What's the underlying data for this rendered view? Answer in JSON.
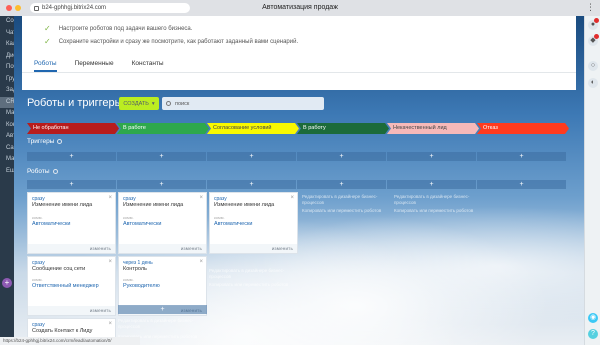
{
  "browser": {
    "url": "b24-gphhgj.bitrix24.com",
    "title": "Автоматизация продаж",
    "menu": "⋮"
  },
  "left_nav": {
    "items": [
      "Сооб",
      "Чат",
      "Кале",
      "Диск",
      "Поч",
      "Груп",
      "Зада",
      "CRM",
      "Мар",
      "Кон",
      "Авто",
      "Сай",
      "Маг",
      "Ещё"
    ],
    "active_index": 7,
    "plus": "+"
  },
  "hints": [
    "Настроите роботов под задачи вашего бизнеса.",
    "Сохраните настройки и сразу же посмотрите, как работают заданный вами сценарий."
  ],
  "tabs": [
    "Роботы",
    "Переменные",
    "Константы"
  ],
  "page": {
    "title": "Роботы и триггеры",
    "create_label": "СОЗДАТЬ",
    "search_value": "поиск"
  },
  "stages": [
    {
      "label": "Не обработан",
      "color": "#b71c1c",
      "text": "#ffffff"
    },
    {
      "label": "В работе",
      "color": "#2ea84c",
      "text": "#ffffff"
    },
    {
      "label": "Согласование условий",
      "color": "#f8f800",
      "text": "#444444"
    },
    {
      "label": "В работу",
      "color": "#1c6b3a",
      "text": "#ffffff"
    },
    {
      "label": "Некачественный лид",
      "color": "#f6b9b9",
      "text": "#444444"
    },
    {
      "label": "Отказ",
      "color": "#ff3b1f",
      "text": "#ffffff"
    }
  ],
  "sections": {
    "triggers": "Триггеры",
    "robots": "Роботы"
  },
  "add_symbol": "+",
  "cards": [
    {
      "when": "сразу",
      "name": "Изменение имени лида",
      "field": "комм.",
      "value": "Автоматически",
      "edit": "изменить"
    },
    {
      "when": "сразу",
      "name": "Изменение имени лида",
      "field": "комм.",
      "value": "Автоматически",
      "edit": "изменить"
    },
    {
      "when": "сразу",
      "name": "Изменение имени лида",
      "field": "комм.",
      "value": "Автоматически",
      "edit": "изменить"
    },
    {
      "when": "сразу",
      "name": "Сообщение соц сети",
      "field": "комм.",
      "value": "Ответственный менеджер",
      "edit": "изменить"
    },
    {
      "when": "через 1 день",
      "name": "Контроль",
      "field": "комм.",
      "value": "Руководителю",
      "edit": "изменить"
    },
    {
      "when": "сразу",
      "name": "Создать Контакт к Лиду",
      "field": "комм.",
      "value": "Ответственный менеджер",
      "edit": "изменить"
    }
  ],
  "ghost_texts": [
    "Редактировать в дизайнере бизнес-процессов",
    "Копировать или переместить роботов",
    "Редактировать в дизайнере бизнес-процессов",
    "Копировать или переместить роботов",
    "Редактировать в дизайнере бизнес-процессов",
    "Копировать или переместить роботов",
    "Редактировать в дизайнере бизнес-процессов",
    "Копировать или переместить роботов"
  ],
  "status_bar": "https://b24-gphhgj.bitrix24.com/crm/lead/automation/0/"
}
